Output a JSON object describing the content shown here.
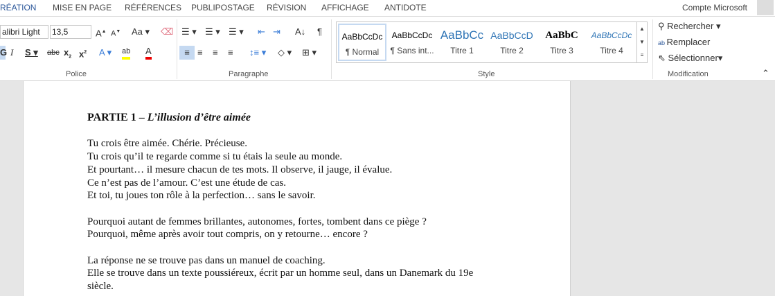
{
  "tabs": [
    "RÉATION",
    "MISE EN PAGE",
    "RÉFÉRENCES",
    "PUBLIPOSTAGE",
    "RÉVISION",
    "AFFICHAGE",
    "ANTIDOTE"
  ],
  "account": "Compte Microsoft",
  "font": {
    "name": "alibri Light",
    "size": "13,5",
    "group": "Police"
  },
  "paragraph": {
    "group": "Paragraphe"
  },
  "styles": {
    "group": "Style",
    "items": [
      {
        "preview": "AaBbCcDc",
        "name": "¶ Normal"
      },
      {
        "preview": "AaBbCcDc",
        "name": "¶ Sans int..."
      },
      {
        "preview": "AaBbCc",
        "name": "Titre 1"
      },
      {
        "preview": "AaBbCcD",
        "name": "Titre 2"
      },
      {
        "preview": "AaBbC",
        "name": "Titre 3"
      },
      {
        "preview": "AaBbCcDc",
        "name": "Titre 4"
      }
    ]
  },
  "editing": {
    "group": "Modification",
    "find": "Rechercher",
    "replace": "Remplacer",
    "select": "Sélectionner"
  },
  "document": {
    "heading_a": "PARTIE 1 – ",
    "heading_b": "L’illusion d’être aimée",
    "lines": [
      "",
      "Tu crois être aimée. Chérie. Précieuse.",
      "Tu crois qu’il te regarde comme si tu étais la seule au monde.",
      "Et pourtant… il mesure chacun de tes mots. Il observe, il jauge, il évalue.",
      "Ce n’est pas de l’amour. C’est une étude de cas.",
      "Et toi, tu joues ton rôle à la perfection… sans le savoir.",
      "",
      "Pourquoi autant de femmes brillantes, autonomes, fortes, tombent dans ce piège ?",
      "Pourquoi, même après avoir tout compris, on y retourne… encore ?",
      "",
      "La réponse ne se trouve pas dans un manuel de coaching.",
      "Elle se trouve dans un texte poussiéreux, écrit par un homme seul, dans un Danemark du 19e",
      "siècle."
    ]
  }
}
